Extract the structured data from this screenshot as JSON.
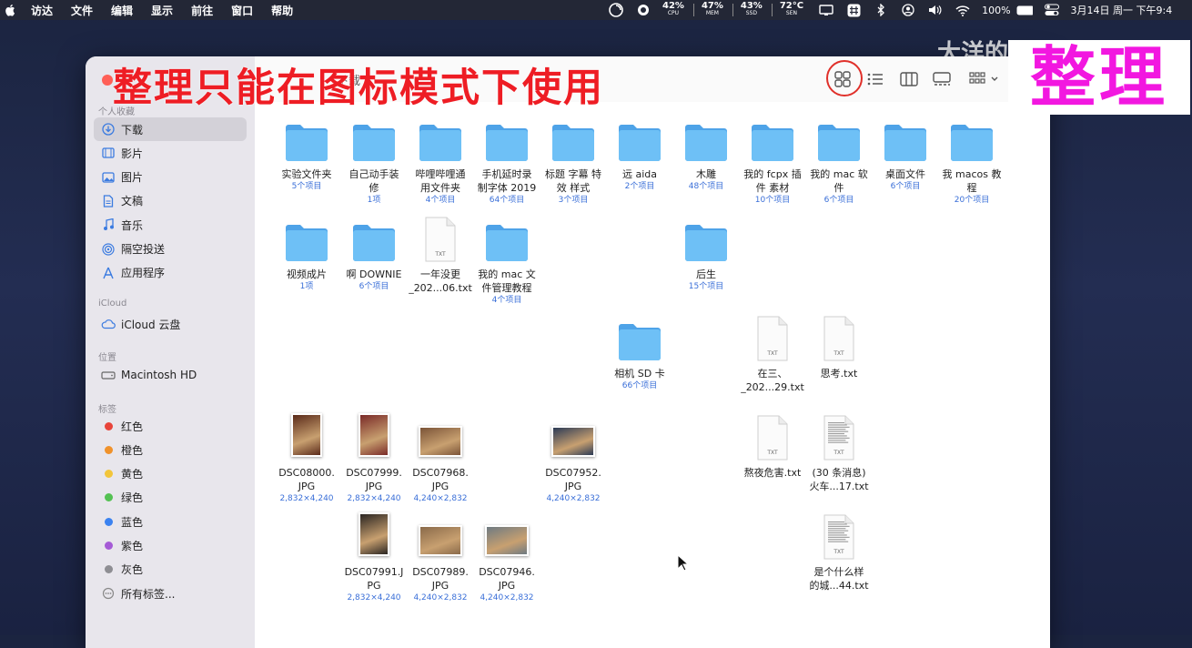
{
  "menubar": {
    "app": "访达",
    "items": [
      "文件",
      "编辑",
      "显示",
      "前往",
      "窗口",
      "帮助"
    ],
    "stats": [
      {
        "value": "42%",
        "label": "CPU"
      },
      {
        "value": "47%",
        "label": "MEM"
      },
      {
        "value": "43%",
        "label": "SSD"
      },
      {
        "value": "72°C",
        "label": "SEN"
      }
    ],
    "battery": "100%",
    "clock": "3月14日 周一 下午9:4"
  },
  "overlay": {
    "title": "整理只能在图标模式下使用",
    "watermark": "大洋的朝九晚十",
    "big_label": "整理"
  },
  "window": {
    "title": "下载"
  },
  "sidebar": {
    "favorites_header": "个人收藏",
    "favorites": [
      {
        "label": "下载",
        "icon": "download-icon",
        "selected": true
      },
      {
        "label": "影片",
        "icon": "film-icon"
      },
      {
        "label": "图片",
        "icon": "photo-icon"
      },
      {
        "label": "文稿",
        "icon": "document-icon"
      },
      {
        "label": "音乐",
        "icon": "music-icon"
      },
      {
        "label": "隔空投送",
        "icon": "airdrop-icon"
      },
      {
        "label": "应用程序",
        "icon": "apps-icon"
      }
    ],
    "icloud_header": "iCloud",
    "icloud": [
      {
        "label": "iCloud 云盘",
        "icon": "cloud-icon"
      }
    ],
    "locations_header": "位置",
    "locations": [
      {
        "label": "Macintosh HD",
        "icon": "disk-icon"
      }
    ],
    "tags_header": "标签",
    "tags": [
      {
        "label": "红色",
        "color": "#e8443a"
      },
      {
        "label": "橙色",
        "color": "#f0922b"
      },
      {
        "label": "黄色",
        "color": "#f2c53a"
      },
      {
        "label": "绿色",
        "color": "#54c153"
      },
      {
        "label": "蓝色",
        "color": "#3b82f0"
      },
      {
        "label": "紫色",
        "color": "#a55bd6"
      },
      {
        "label": "灰色",
        "color": "#8e8e93"
      }
    ],
    "all_tags": "所有标签..."
  },
  "files": [
    {
      "type": "folder",
      "name": [
        "实验文件夹"
      ],
      "sub": "5个项目"
    },
    {
      "type": "folder",
      "name": [
        "自己动手装",
        "修"
      ],
      "sub": "1项"
    },
    {
      "type": "folder",
      "name": [
        "哔哩哔哩通",
        "用文件夹"
      ],
      "sub": "4个项目"
    },
    {
      "type": "folder",
      "name": [
        "手机延时录",
        "制字体 2019"
      ],
      "sub": "64个项目"
    },
    {
      "type": "folder",
      "name": [
        "标题 字幕 特",
        "效 样式"
      ],
      "sub": "3个项目"
    },
    {
      "type": "folder",
      "name": [
        "远 aida"
      ],
      "sub": "2个项目"
    },
    {
      "type": "folder",
      "name": [
        "木雕"
      ],
      "sub": "48个项目"
    },
    {
      "type": "folder",
      "name": [
        "我的 fcpx 插",
        "件 素材"
      ],
      "sub": "10个项目"
    },
    {
      "type": "folder",
      "name": [
        "我的 mac 软",
        "件"
      ],
      "sub": "6个项目"
    },
    {
      "type": "folder",
      "name": [
        "桌面文件"
      ],
      "sub": "6个项目"
    },
    {
      "type": "folder",
      "name": [
        "我 macos 教",
        "程"
      ],
      "sub": "20个项目"
    },
    {
      "type": "folder",
      "name": [
        "视频成片"
      ],
      "sub": "1项"
    },
    {
      "type": "folder",
      "name": [
        "啊 DOWNIE"
      ],
      "sub": "6个项目"
    },
    {
      "type": "txt",
      "name": [
        "一年没更",
        "_202...06.txt"
      ],
      "sub": ""
    },
    {
      "type": "folder",
      "name": [
        "我的 mac 文",
        "件管理教程"
      ],
      "sub": "4个项目"
    },
    {
      "type": "folder",
      "name": [
        "后生"
      ],
      "sub": "15个项目"
    },
    {
      "type": "folder",
      "name": [
        "相机 SD 卡"
      ],
      "sub": "66个项目"
    },
    {
      "type": "txt",
      "name": [
        "在三、",
        "_202...29.txt"
      ],
      "sub": ""
    },
    {
      "type": "txt",
      "name": [
        "思考.txt"
      ],
      "sub": ""
    },
    {
      "type": "photo",
      "name": [
        "DSC08000.",
        "JPG"
      ],
      "sub": "2,832×4,240"
    },
    {
      "type": "photo",
      "name": [
        "DSC07999.",
        "JPG"
      ],
      "sub": "2,832×4,240"
    },
    {
      "type": "photo",
      "name": [
        "DSC07968.",
        "JPG"
      ],
      "sub": "4,240×2,832"
    },
    {
      "type": "photo",
      "name": [
        "DSC07952.",
        "JPG"
      ],
      "sub": "4,240×2,832"
    },
    {
      "type": "txt",
      "name": [
        "熬夜危害.txt"
      ],
      "sub": ""
    },
    {
      "type": "txtdoc",
      "name": [
        "(30 条消息)",
        "火车...17.txt"
      ],
      "sub": ""
    },
    {
      "type": "photo",
      "name": [
        "DSC07991.J",
        "PG"
      ],
      "sub": "2,832×4,240"
    },
    {
      "type": "photo",
      "name": [
        "DSC07989.",
        "JPG"
      ],
      "sub": "4,240×2,832"
    },
    {
      "type": "photo",
      "name": [
        "DSC07946.",
        "JPG"
      ],
      "sub": "4,240×2,832"
    },
    {
      "type": "txtdoc",
      "name": [
        "是个什么样",
        "的城...44.txt"
      ],
      "sub": ""
    }
  ],
  "txt_badge": "TXT"
}
